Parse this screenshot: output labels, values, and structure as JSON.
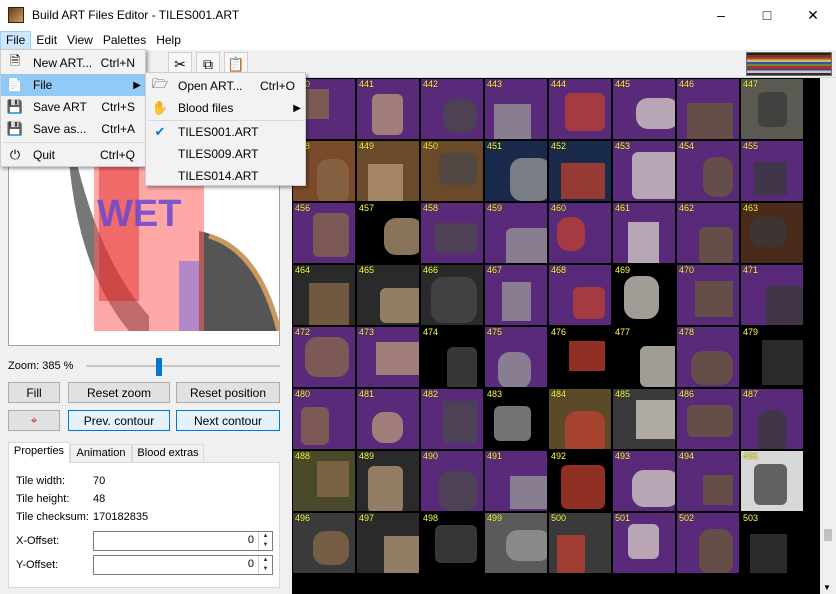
{
  "window": {
    "title": "Build ART Files Editor - TILES001.ART"
  },
  "menubar": {
    "items": [
      "File",
      "Edit",
      "View",
      "Palettes",
      "Help"
    ]
  },
  "file_menu": {
    "items": [
      {
        "label": "New ART...",
        "shortcut": "Ctrl+N",
        "icon": "new-file-icon"
      },
      {
        "label": "File",
        "shortcut": "",
        "icon": "file-icon",
        "submenu": true
      },
      {
        "label": "Save ART",
        "shortcut": "Ctrl+S",
        "icon": "save-icon"
      },
      {
        "label": "Save as...",
        "shortcut": "Ctrl+A",
        "icon": "save-as-icon"
      },
      {
        "label": "Quit",
        "shortcut": "Ctrl+Q",
        "icon": "power-icon"
      }
    ]
  },
  "file_submenu": {
    "items": [
      {
        "label": "Open ART...",
        "shortcut": "Ctrl+O",
        "icon": "folder-open-icon"
      },
      {
        "label": "Blood files",
        "shortcut": "",
        "icon": "blood-hand-icon",
        "submenu": true
      },
      {
        "label": "TILES001.ART",
        "checked": true
      },
      {
        "label": "TILES009.ART",
        "checked": false
      },
      {
        "label": "TILES014.ART",
        "checked": false
      }
    ]
  },
  "toolbar": {
    "icons": [
      "cut-icon",
      "copy-icon",
      "paste-icon"
    ]
  },
  "preview": {
    "zoom_label": "Zoom: 385 %",
    "zoom_percent": 385,
    "slider_fraction": 0.36,
    "sign_text": "WET"
  },
  "buttons": {
    "fill": "Fill",
    "reset_zoom": "Reset zoom",
    "reset_position": "Reset position",
    "prev_contour": "Prev. contour",
    "next_contour": "Next contour"
  },
  "tabs": [
    "Properties",
    "Animation",
    "Blood extras"
  ],
  "properties": {
    "tile_width_label": "Tile width:",
    "tile_width": "70",
    "tile_height_label": "Tile height:",
    "tile_height": "48",
    "checksum_label": "Tile checksum:",
    "checksum": "170182835",
    "x_offset_label": "X-Offset:",
    "x_offset": "0",
    "y_offset_label": "Y-Offset:",
    "y_offset": "0"
  },
  "tiles": [
    {
      "n": "440",
      "c": "#5a2a7a"
    },
    {
      "n": "441",
      "c": "#5a2a7a"
    },
    {
      "n": "442",
      "c": "#5a2a7a"
    },
    {
      "n": "443",
      "c": "#5a2a7a"
    },
    {
      "n": "444",
      "c": "#5a2a7a"
    },
    {
      "n": "445",
      "c": "#5a2a7a"
    },
    {
      "n": "446",
      "c": "#5a2a7a"
    },
    {
      "n": "447",
      "c": "#5a5a52"
    },
    {
      "n": "448",
      "c": "#7a4a2a"
    },
    {
      "n": "449",
      "c": "#6a4a2a"
    },
    {
      "n": "450",
      "c": "#6a4a2a"
    },
    {
      "n": "451",
      "c": "#1a2a4a"
    },
    {
      "n": "452",
      "c": "#1a2a4a"
    },
    {
      "n": "453",
      "c": "#5a2a7a"
    },
    {
      "n": "454",
      "c": "#5a2a7a"
    },
    {
      "n": "455",
      "c": "#5a2a7a"
    },
    {
      "n": "456",
      "c": "#5a2a7a"
    },
    {
      "n": "457",
      "c": "#000000"
    },
    {
      "n": "458",
      "c": "#5a2a7a"
    },
    {
      "n": "459",
      "c": "#5a2a7a"
    },
    {
      "n": "460",
      "c": "#5a2a7a"
    },
    {
      "n": "461",
      "c": "#5a2a7a"
    },
    {
      "n": "462",
      "c": "#5a2a7a"
    },
    {
      "n": "463",
      "c": "#4a2a1a"
    },
    {
      "n": "464",
      "c": "#2a2a2a"
    },
    {
      "n": "465",
      "c": "#2a2a2a"
    },
    {
      "n": "466",
      "c": "#2a2a2a"
    },
    {
      "n": "467",
      "c": "#5a2a7a"
    },
    {
      "n": "468",
      "c": "#5a2a7a"
    },
    {
      "n": "469",
      "c": "#000000"
    },
    {
      "n": "470",
      "c": "#5a2a7a"
    },
    {
      "n": "471",
      "c": "#5a2a7a"
    },
    {
      "n": "472",
      "c": "#5a2a7a"
    },
    {
      "n": "473",
      "c": "#5a2a7a"
    },
    {
      "n": "474",
      "c": "#000000"
    },
    {
      "n": "475",
      "c": "#5a2a7a"
    },
    {
      "n": "476",
      "c": "#000000"
    },
    {
      "n": "477",
      "c": "#000000"
    },
    {
      "n": "478",
      "c": "#5a2a7a"
    },
    {
      "n": "479",
      "c": "#000000"
    },
    {
      "n": "480",
      "c": "#5a2a7a"
    },
    {
      "n": "481",
      "c": "#5a2a7a"
    },
    {
      "n": "482",
      "c": "#5a2a7a"
    },
    {
      "n": "483",
      "c": "#000000"
    },
    {
      "n": "484",
      "c": "#5a4a2a"
    },
    {
      "n": "485",
      "c": "#3a3a3a"
    },
    {
      "n": "486",
      "c": "#5a2a7a"
    },
    {
      "n": "487",
      "c": "#5a2a7a"
    },
    {
      "n": "488",
      "c": "#4a4a2a"
    },
    {
      "n": "489",
      "c": "#2a2a2a"
    },
    {
      "n": "490",
      "c": "#5a2a7a"
    },
    {
      "n": "491",
      "c": "#5a2a7a"
    },
    {
      "n": "492",
      "c": "#000000"
    },
    {
      "n": "493",
      "c": "#5a2a7a"
    },
    {
      "n": "494",
      "c": "#5a2a7a"
    },
    {
      "n": "495",
      "c": "#d8d8d8"
    },
    {
      "n": "496",
      "c": "#3a3a3a"
    },
    {
      "n": "497",
      "c": "#2a2a2a"
    },
    {
      "n": "498",
      "c": "#000000"
    },
    {
      "n": "499",
      "c": "#5a5a5a"
    },
    {
      "n": "500",
      "c": "#3a3a3a"
    },
    {
      "n": "501",
      "c": "#5a2a7a"
    },
    {
      "n": "502",
      "c": "#5a2a7a"
    },
    {
      "n": "503",
      "c": "#000000"
    }
  ],
  "colors": {
    "accent": "#0078d7",
    "menu_highlight": "#91c9f7",
    "tile_number": "#ffff40",
    "transparent_purple": "#5a2a7a"
  }
}
